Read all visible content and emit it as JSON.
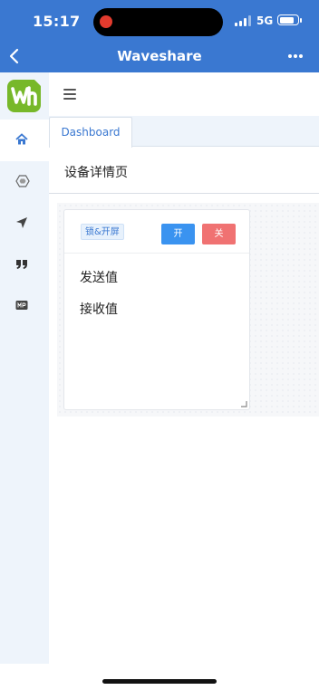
{
  "status_bar": {
    "time": "15:17",
    "network": "5G",
    "battery_level": 0.85
  },
  "nav": {
    "title": "Waveshare",
    "back_icon": "chevron-left-icon",
    "more_icon": "more-dots-icon"
  },
  "sidebar": {
    "logo": "waveshare-logo",
    "items": [
      {
        "icon": "home-icon",
        "active": true
      },
      {
        "icon": "hexagon-icon",
        "active": false
      },
      {
        "icon": "location-arrow-icon",
        "active": false
      },
      {
        "icon": "quote-icon",
        "active": false
      },
      {
        "icon": "mp-icon",
        "active": false
      }
    ]
  },
  "topbar": {
    "menu_icon": "hamburger-menu-icon"
  },
  "tabs": [
    {
      "label": "Dashboard",
      "active": true
    }
  ],
  "page": {
    "title": "设备详情页"
  },
  "card": {
    "tag": "锁&开屏",
    "on_button": "开",
    "off_button": "关",
    "send_label": "发送值",
    "receive_label": "接收值"
  },
  "colors": {
    "primary": "#3a78d1",
    "on": "#3a93f0",
    "off": "#f07272",
    "sidebar_bg": "#eef4fb"
  }
}
